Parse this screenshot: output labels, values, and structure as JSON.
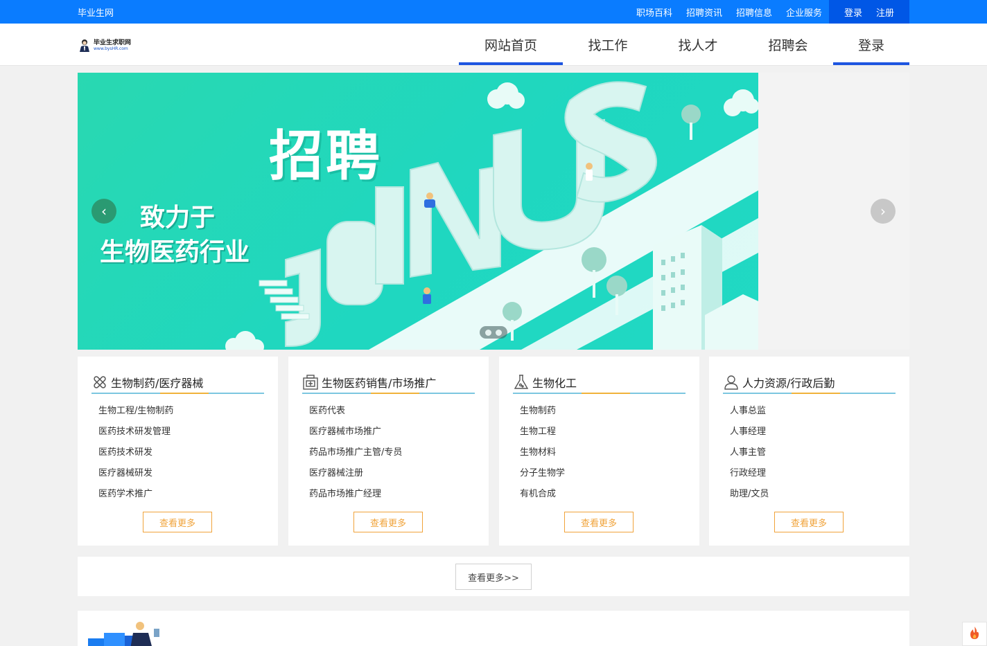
{
  "topbar": {
    "site_name": "毕业生网",
    "links": [
      "职场百科",
      "招聘资讯",
      "招聘信息",
      "企业服务"
    ],
    "login": "登录",
    "register": "注册"
  },
  "logo": {
    "name": "毕业生求职网",
    "domain": "www.bysHR.com"
  },
  "nav": {
    "items": [
      "网站首页",
      "找工作",
      "找人才",
      "招聘会",
      "登录"
    ]
  },
  "banner": {
    "title": "招聘",
    "subtitle_line1": "致力于",
    "subtitle_line2": "生物医药行业",
    "decor_text": "JOIN US"
  },
  "categories": [
    {
      "title": "生物制药/医疗器械",
      "icon": "medical-cross-icon",
      "items": [
        "生物工程/生物制药",
        "医药技术研发管理",
        "医药技术研发",
        "医疗器械研发",
        "医药学术推广"
      ],
      "more": "查看更多"
    },
    {
      "title": "生物医药销售/市场推广",
      "icon": "medicine-box-icon",
      "items": [
        "医药代表",
        "医疗器械市场推广",
        "药品市场推广主管/专员",
        "医疗器械注册",
        "药品市场推广经理"
      ],
      "more": "查看更多"
    },
    {
      "title": "生物化工",
      "icon": "flask-icon",
      "items": [
        "生物制药",
        "生物工程",
        "生物材料",
        "分子生物学",
        "有机合成"
      ],
      "more": "查看更多"
    },
    {
      "title": "人力资源/行政后勤",
      "icon": "user-icon",
      "items": [
        "人事总监",
        "人事经理",
        "人事主管",
        "行政经理",
        "助理/文员"
      ],
      "more": "查看更多"
    }
  ],
  "more_all": "查看更多>>",
  "colors": {
    "topbar": "#0a7cff",
    "topbar_auth": "#0057e6",
    "nav_active": "#1d55e0",
    "accent_orange": "#f0a33a",
    "line_blue": "#7cc6e0",
    "banner_teal": "#22d8bc"
  }
}
